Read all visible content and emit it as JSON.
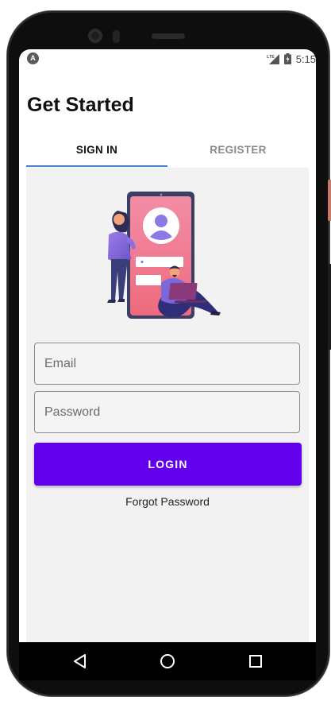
{
  "status_bar": {
    "time": "5:15",
    "left_icon": "A",
    "network": "LTE",
    "icons": [
      "notification-a-icon",
      "lte-signal-icon",
      "battery-icon"
    ]
  },
  "screen": {
    "title": "Get Started",
    "tabs": [
      {
        "label": "SIGN IN",
        "active": true
      },
      {
        "label": "REGISTER",
        "active": false
      }
    ],
    "illustration": "login-illustration",
    "form": {
      "email_placeholder": "Email",
      "password_placeholder": "Password",
      "login_label": "LOGIN",
      "forgot_label": "Forgot Password"
    }
  },
  "nav_bar": {
    "icons": [
      "back-icon",
      "home-icon",
      "recents-icon"
    ]
  },
  "colors": {
    "accent": "#6200ee",
    "tab_indicator": "#3d84d8",
    "content_background": "#f2f2f2"
  }
}
